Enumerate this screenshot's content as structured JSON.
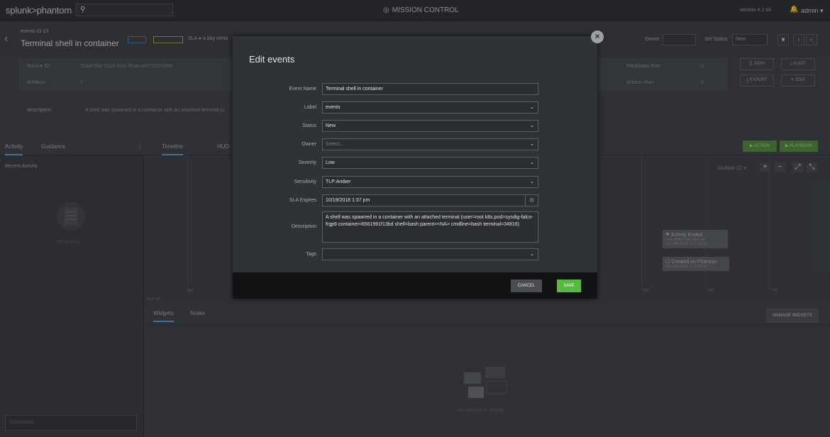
{
  "topbar": {
    "logo": "splunk>phantom",
    "mission_control": "MISSION CONTROL",
    "version": "version 4.1.94",
    "user": "admin"
  },
  "event": {
    "id_label": "events ID 13",
    "title": "Terminal shell in container",
    "sla_text": "SLA ● a day rema",
    "owner_label": "Owner",
    "set_status_label": "Set Status",
    "set_status_value": "New"
  },
  "info": {
    "source_id_label": "Source ID:",
    "source_id_value": "15aa02bb-5a18-4fda-8bab-ae0753003f55",
    "artifacts_label": "Artifacts:",
    "artifacts_value": "0",
    "playbooks_label": "Playbooks Run:",
    "playbooks_value": "0",
    "actions_label": "Actions Run:",
    "actions_value": "0",
    "json": "JSON",
    "audit": "AUDIT",
    "export": "EXPORT",
    "edit": "EDIT",
    "description_label": "description:",
    "description_value": "A shell was spawned in a container with an attached terminal (u"
  },
  "tabs": {
    "activity": "Activity",
    "guidance": "Guidance",
    "timeline": "Timeline",
    "hud": "HUD",
    "action": "▶ ACTION",
    "playbook": "▶ PLAYBOOK"
  },
  "left_panel": {
    "recent_activity": "Recent Activity",
    "no_activity": "No activity",
    "comments_placeholder": "Comments"
  },
  "timeline": {
    "multiple": "Multiple (2) ▾",
    "event1_title": "⚑ Activity Ended",
    "event1_sub1": "Last artifact was seen on",
    "event1_sub2": "Oct 18th 2018, 1:37:16 pm",
    "event2_title": "☐ Created on Phantom",
    "event2_sub": "Oct 18th 2018, 1:37:16 pm",
    "axis_start": "13:37:16",
    "axis_labels": [
      "900",
      "500",
      "900",
      "700"
    ]
  },
  "widgets": {
    "widgets_tab": "Widgets",
    "notes_tab": "Notes",
    "manage": "MANAGE WIDGETS",
    "none": "No widgets to display"
  },
  "modal": {
    "title": "Edit events",
    "fields": {
      "event_name_label": "Event Name",
      "event_name_value": "Terminal shell in container",
      "label_label": "Label",
      "label_value": "events",
      "status_label": "Status",
      "status_value": "New",
      "owner_label": "Owner",
      "owner_placeholder": "Select...",
      "severity_label": "Severity",
      "severity_value": "Low",
      "sensitivity_label": "Sensitivity",
      "sensitivity_value": "TLP:Amber",
      "sla_label": "SLA Expires",
      "sla_value": "10/19/2018 1:37 pm",
      "description_label": "Description",
      "description_value": "A shell was spawned in a container with an attached terminal (user=root k8s.pod=sysdig-falco-frgp9 container=6561991f13bd shell=bash parent=<NA> cmdline=bash terminal=34816)",
      "tags_label": "Tags"
    },
    "cancel": "CANCEL",
    "save": "SAVE"
  }
}
